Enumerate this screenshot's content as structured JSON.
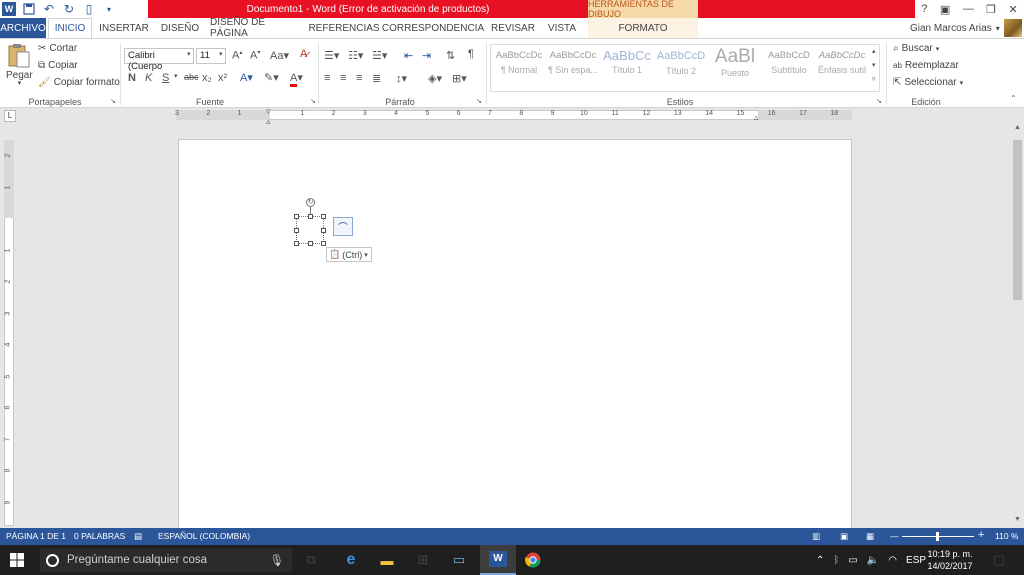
{
  "window": {
    "title": "Documento1 - Word (Error de activación de productos)",
    "contextual_tools": "HERRAMIENTAS DE DIBUJO",
    "user": "Gian Marcos Arias",
    "controls": {
      "help": "?",
      "ribbon_display": "▣",
      "minimize": "—",
      "restore": "❐",
      "close": "✕"
    }
  },
  "tabs": [
    "ARCHIVO",
    "INICIO",
    "INSERTAR",
    "DISEÑO",
    "DISEÑO DE PÁGINA",
    "REFERENCIAS",
    "CORRESPONDENCIA",
    "REVISAR",
    "VISTA",
    "FORMATO"
  ],
  "clipboard": {
    "paste": "Pegar",
    "cut": "Cortar",
    "copy": "Copiar",
    "format_painter": "Copiar formato",
    "label": "Portapapeles"
  },
  "font": {
    "name": "Calibri (Cuerpo",
    "size": "11",
    "label": "Fuente",
    "bold": "N",
    "italic": "K",
    "underline": "S",
    "strike": "abc",
    "sub": "x₂",
    "sup": "x²"
  },
  "paragraph": {
    "label": "Párrafo",
    "pilcrow": "¶"
  },
  "styles": {
    "label": "Estilos",
    "items": [
      {
        "sample": "AaBbCcDc",
        "name": "¶ Normal"
      },
      {
        "sample": "AaBbCcDc",
        "name": "¶ Sin espa..."
      },
      {
        "sample": "AaBbCc",
        "name": "Título 1"
      },
      {
        "sample": "AaBbCcD",
        "name": "Título 2"
      },
      {
        "sample": "AaBl",
        "name": "Puesto"
      },
      {
        "sample": "AaBbCcD",
        "name": "Subtítulo"
      },
      {
        "sample": "AaBbCcDc",
        "name": "Énfasis sutil"
      }
    ]
  },
  "editing": {
    "find": "Buscar",
    "replace": "Reemplazar",
    "select": "Seleccionar",
    "label": "Edición"
  },
  "ruler": {
    "tab_selector": "L",
    "numbers": [
      "3",
      "2",
      "1",
      "1",
      "2",
      "3",
      "4",
      "5",
      "6",
      "7",
      "8",
      "9",
      "10",
      "11",
      "12",
      "13",
      "14",
      "15",
      "16",
      "17",
      "18"
    ],
    "vertical": [
      "2",
      "1",
      "1",
      "2",
      "3",
      "4",
      "5",
      "6",
      "7",
      "8",
      "9"
    ]
  },
  "document": {
    "paste_options": "(Ctrl)"
  },
  "status": {
    "page": "PÁGINA 1 DE 1",
    "words": "0 PALABRAS",
    "language": "ESPAÑOL (COLOMBIA)",
    "zoom": "110 %",
    "zoom_minus": "—",
    "zoom_plus": "+"
  },
  "taskbar": {
    "search_placeholder": "Pregúntame cualquier cosa",
    "lang": "ESP",
    "time": "10:19 p. m.",
    "date": "14/02/2017"
  }
}
